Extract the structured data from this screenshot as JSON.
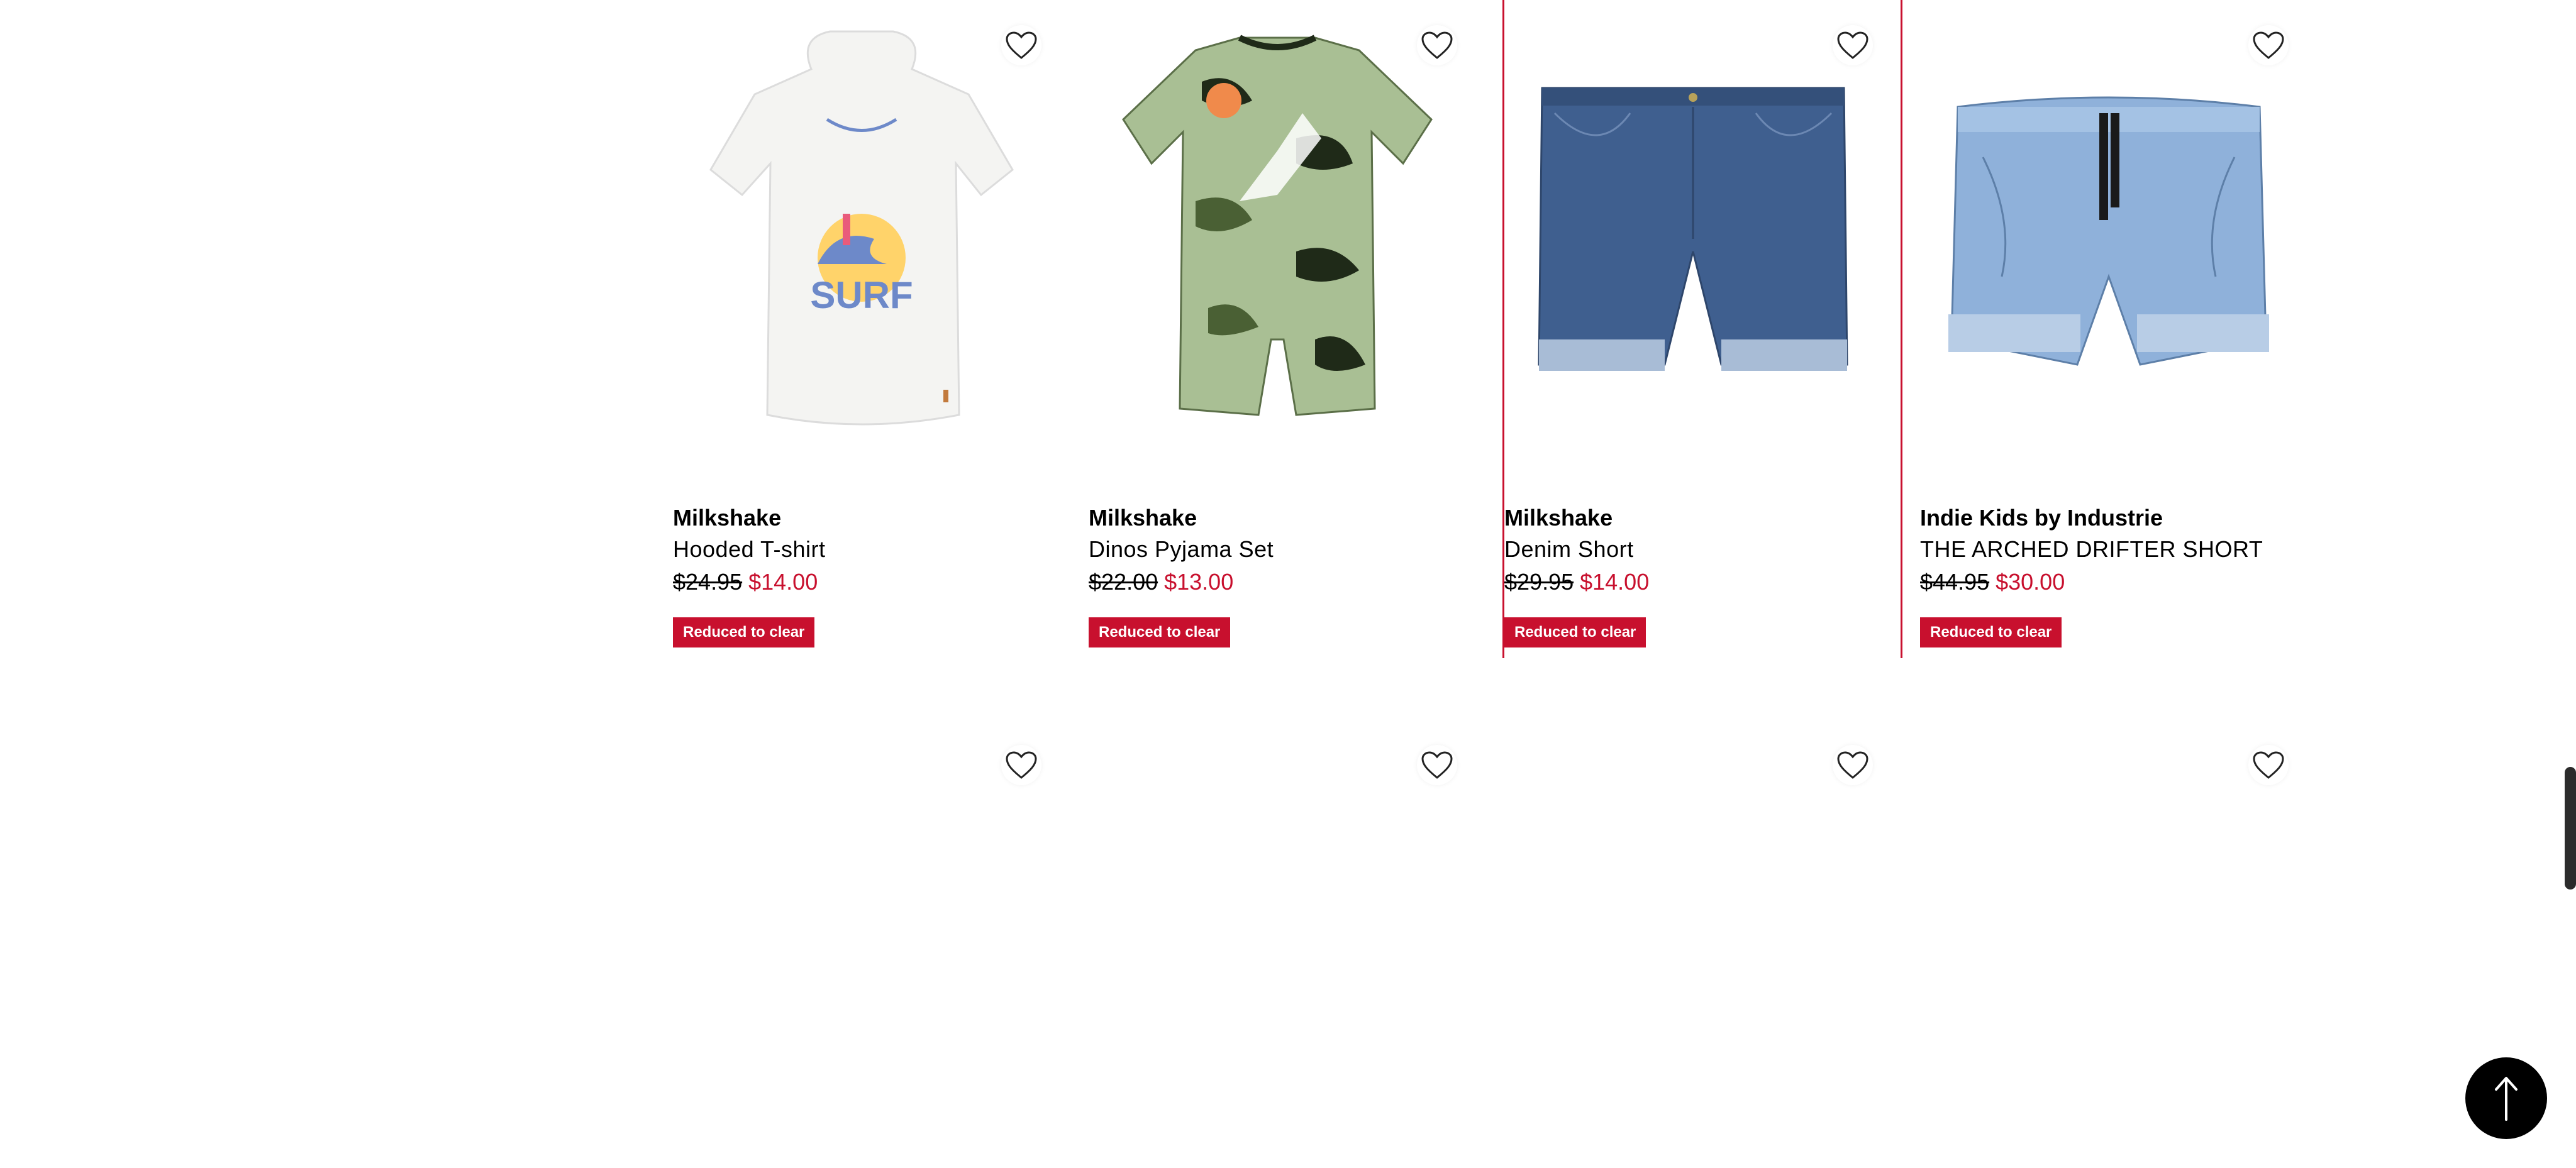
{
  "products": [
    {
      "brand": "Milkshake",
      "name": "Hooded T-shirt",
      "was": "$24.95",
      "now": "$14.00",
      "badge": "Reduced to clear",
      "image": "white-hooded-tshirt-surf"
    },
    {
      "brand": "Milkshake",
      "name": "Dinos Pyjama Set",
      "was": "$22.00",
      "now": "$13.00",
      "badge": "Reduced to clear",
      "image": "camo-dino-pyjama"
    },
    {
      "brand": "Milkshake",
      "name": "Denim Short",
      "was": "$29.95",
      "now": "$14.00",
      "badge": "Reduced to clear",
      "image": "denim-shorts"
    },
    {
      "brand": "Indie Kids by Industrie",
      "name": "THE ARCHED DRIFTER SHORT",
      "was": "$44.95",
      "now": "$30.00",
      "badge": "Reduced to clear",
      "image": "light-denim-drawstring-shorts"
    }
  ],
  "colors": {
    "sale": "#c8102e",
    "text": "#000000",
    "background": "#ffffff"
  },
  "icons": {
    "favourite": "heart-outline-icon",
    "back_to_top": "arrow-up-icon"
  }
}
